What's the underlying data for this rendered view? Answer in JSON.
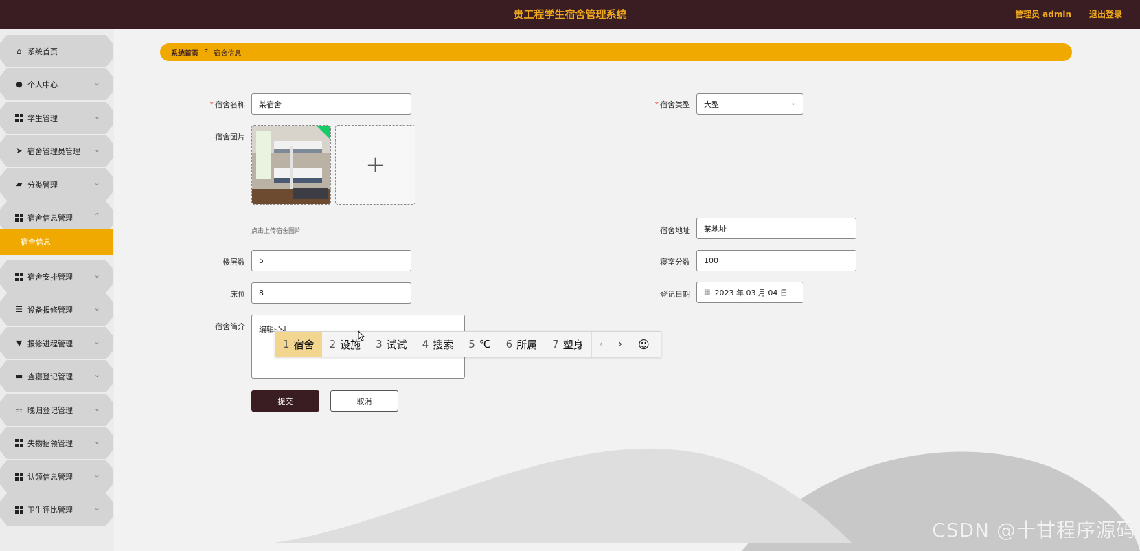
{
  "header": {
    "title": "贵工程学生宿舍管理系统",
    "user": "管理员 admin",
    "logout": "退出登录"
  },
  "sidebar": {
    "items": [
      {
        "label": "系统首页",
        "icon": "home-icon"
      },
      {
        "label": "个人中心",
        "icon": "user-icon"
      },
      {
        "label": "学生管理",
        "icon": "grid-icon"
      },
      {
        "label": "宿舍管理员管理",
        "icon": "send-icon"
      },
      {
        "label": "分类管理",
        "icon": "wallet-icon"
      },
      {
        "label": "宿舍信息管理",
        "icon": "grid-icon",
        "expanded": true
      },
      {
        "label": "宿舍安排管理",
        "icon": "grid-icon"
      },
      {
        "label": "设备报修管理",
        "icon": "list-icon"
      },
      {
        "label": "报修进程管理",
        "icon": "flag-icon"
      },
      {
        "label": "查寝登记管理",
        "icon": "printer-icon"
      },
      {
        "label": "晚归登记管理",
        "icon": "sliders-icon"
      },
      {
        "label": "失物招领管理",
        "icon": "grid-icon"
      },
      {
        "label": "认领信息管理",
        "icon": "grid-icon"
      },
      {
        "label": "卫生评比管理",
        "icon": "grid-icon"
      }
    ],
    "active_sub": "宿舍信息"
  },
  "breadcrumb": {
    "home": "系统首页",
    "sep": "Ξ",
    "current": "宿舍信息"
  },
  "form": {
    "name_label": "宿舍名称",
    "name_value": "某宿舍",
    "type_label": "宿舍类型",
    "type_value": "大型",
    "image_label": "宿舍图片",
    "image_hint": "点击上传宿舍图片",
    "address_label": "宿舍地址",
    "address_value": "某地址",
    "floors_label": "楼层数",
    "floors_value": "5",
    "score_label": "寝室分数",
    "score_value": "100",
    "beds_label": "床位",
    "beds_value": "8",
    "date_label": "登记日期",
    "date_value": "2023 年 03 月 04 日",
    "intro_label": "宿舍简介",
    "intro_value": "编辑s'sl",
    "submit": "提交",
    "cancel": "取消"
  },
  "ime": {
    "candidates": [
      {
        "n": "1",
        "text": "宿舍",
        "selected": true
      },
      {
        "n": "2",
        "text": "设施"
      },
      {
        "n": "3",
        "text": "试试"
      },
      {
        "n": "4",
        "text": "搜索"
      },
      {
        "n": "5",
        "text": "℃"
      },
      {
        "n": "6",
        "text": "所属"
      },
      {
        "n": "7",
        "text": "塑身"
      }
    ],
    "prev": "‹",
    "next": "›",
    "emoji": "☺"
  },
  "watermark": "CSDN @十甘程序源码",
  "colors": {
    "header_bg": "#3a1d22",
    "accent": "#f0a900",
    "submit_bg": "#3a1d22"
  }
}
